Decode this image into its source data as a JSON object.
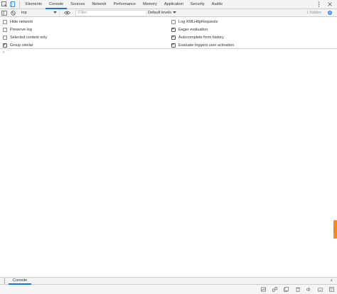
{
  "tabs": {
    "items": [
      {
        "label": "Elements"
      },
      {
        "label": "Console"
      },
      {
        "label": "Sources"
      },
      {
        "label": "Network"
      },
      {
        "label": "Performance"
      },
      {
        "label": "Memory"
      },
      {
        "label": "Application"
      },
      {
        "label": "Security"
      },
      {
        "label": "Audits"
      }
    ],
    "active_index": 1
  },
  "toolbar": {
    "context": "top",
    "filter_placeholder": "Filter",
    "levels_label": "Default levels",
    "hidden_count": "1 hidden"
  },
  "settings": {
    "left": [
      {
        "label": "Hide network",
        "checked": false
      },
      {
        "label": "Preserve log",
        "checked": false
      },
      {
        "label": "Selected context only",
        "checked": false
      },
      {
        "label": "Group similar",
        "checked": true
      }
    ],
    "right": [
      {
        "label": "Log XMLHttpRequests",
        "checked": false
      },
      {
        "label": "Eager evaluation",
        "checked": true
      },
      {
        "label": "Autocomplete from history",
        "checked": true
      },
      {
        "label": "Evaluate triggers user activation",
        "checked": true
      }
    ]
  },
  "console": {
    "prompt": "›"
  },
  "drawer": {
    "tab_label": "Console",
    "close": "×"
  },
  "colors": {
    "accent": "#1a73e8",
    "scroll_handle": "#f08a24",
    "panel_bg": "#f3f3f3"
  },
  "icons": [
    "inspect-icon",
    "device-icon",
    "more-icon",
    "settings-icon",
    "sidebar-icon",
    "clear-icon",
    "eye-icon",
    "gear-icon"
  ]
}
